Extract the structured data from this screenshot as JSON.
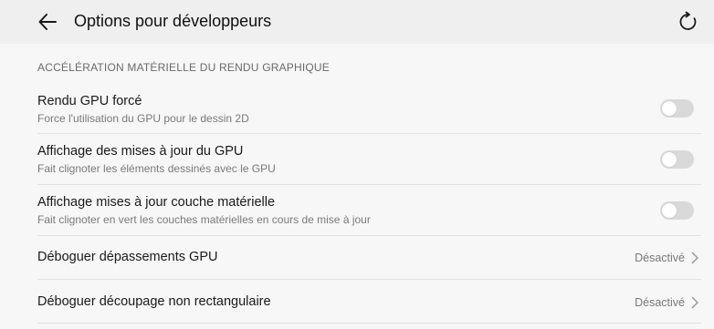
{
  "header": {
    "title": "Options pour développeurs",
    "back_icon": "arrow-left-icon",
    "reset_icon": "refresh-icon"
  },
  "section": {
    "title": "ACCÉLÉRATION MATÉRIELLE DU RENDU GRAPHIQUE"
  },
  "settings": [
    {
      "title": "Rendu GPU forcé",
      "subtitle": "Force l'utilisation du GPU pour le dessin 2D",
      "control": "toggle",
      "enabled": false
    },
    {
      "title": "Affichage des mises à jour du GPU",
      "subtitle": "Fait clignoter les éléments dessinés avec le GPU",
      "control": "toggle",
      "enabled": false
    },
    {
      "title": "Affichage mises à jour couche matérielle",
      "subtitle": "Fait clignoter en vert les couches matérielles en cours de mise à jour",
      "control": "toggle",
      "enabled": false
    },
    {
      "title": "Déboguer dépassements GPU",
      "value": "Désactivé",
      "control": "chevron"
    },
    {
      "title": "Déboguer découpage non rectangulaire",
      "value": "Désactivé",
      "control": "chevron"
    }
  ],
  "colors": {
    "background": "#f7f7f7",
    "app_bar": "#efefef",
    "toggle_off": "#d9d9d9",
    "divider": "#e2e2e2"
  }
}
